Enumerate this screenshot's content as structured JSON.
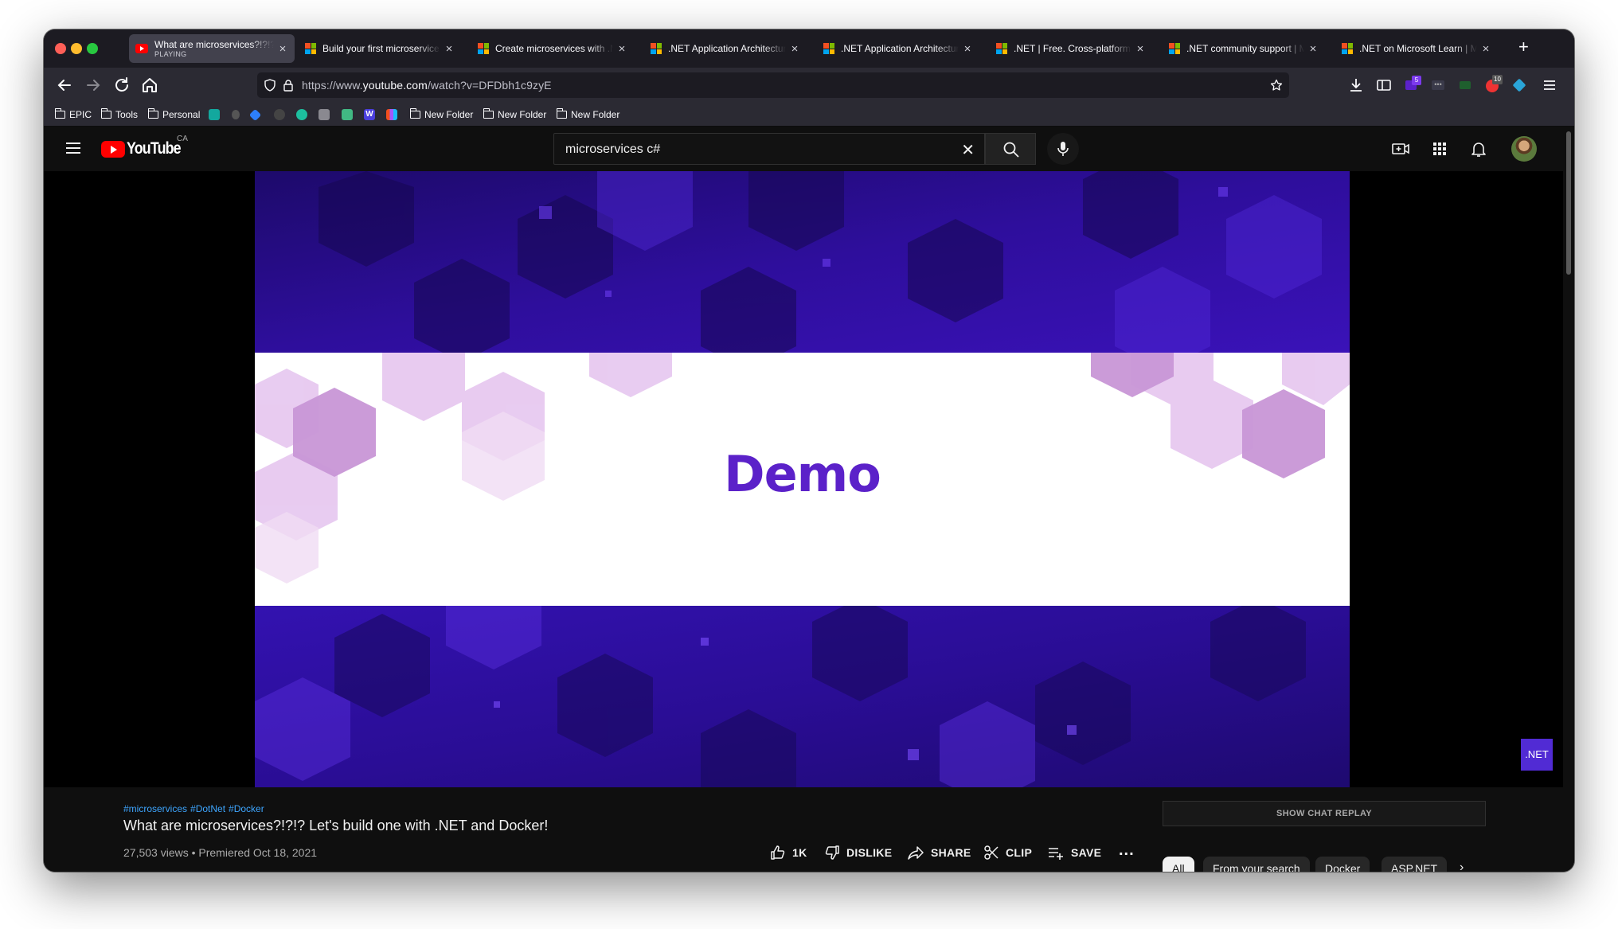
{
  "browser": {
    "tabs": [
      {
        "title": "What are microservices?!?!? Let's build one",
        "subtitle": "PLAYING",
        "favicon": "youtube-icon",
        "active": true
      },
      {
        "title": "Build your first microservice with .NET",
        "favicon": "microsoft-icon"
      },
      {
        "title": "Create microservices with .NET",
        "favicon": "microsoft-icon"
      },
      {
        "title": ".NET Application Architecture Guides",
        "favicon": "microsoft-icon"
      },
      {
        "title": ".NET Application Architecture Guides",
        "favicon": "microsoft-icon"
      },
      {
        "title": ".NET | Free. Cross-platform. Open Source.",
        "favicon": "microsoft-icon"
      },
      {
        "title": ".NET community support | Microsoft",
        "favicon": "microsoft-icon"
      },
      {
        "title": ".NET on Microsoft Learn | Microsoft",
        "favicon": "microsoft-icon"
      }
    ],
    "url_prefix": "https://www.",
    "url_domain": "youtube.com",
    "url_path": "/watch?v=DFDbh1c9zyE",
    "extension_badges": {
      "first": "5",
      "second": "10"
    },
    "bookmarks": [
      {
        "label": "EPIC",
        "type": "folder"
      },
      {
        "label": "Tools",
        "type": "folder"
      },
      {
        "label": "Personal",
        "type": "folder"
      },
      {
        "label": "New Folder",
        "type": "folder"
      },
      {
        "label": "New Folder",
        "type": "folder"
      },
      {
        "label": "New Folder",
        "type": "folder"
      }
    ]
  },
  "youtube": {
    "logo": "YouTube",
    "region": "CA",
    "search_query": "microservices c#",
    "video": {
      "slide_text": "Demo",
      "badge": ".NET"
    },
    "hashtags": [
      "#microservices",
      "#DotNet",
      "#Docker"
    ],
    "title": "What are microservices?!?!? Let's build one with .NET and Docker!",
    "meta": "27,503 views • Premiered Oct 18, 2021",
    "actions": {
      "like": "1K",
      "dislike": "DISLIKE",
      "share": "SHARE",
      "clip": "CLIP",
      "save": "SAVE",
      "more": "..."
    },
    "chat_replay": "SHOW CHAT REPLAY",
    "chips": [
      "All",
      "From your search",
      "Docker",
      "ASP.NET"
    ],
    "accent": "#ff0000",
    "slide_color": "#5b21c9"
  }
}
